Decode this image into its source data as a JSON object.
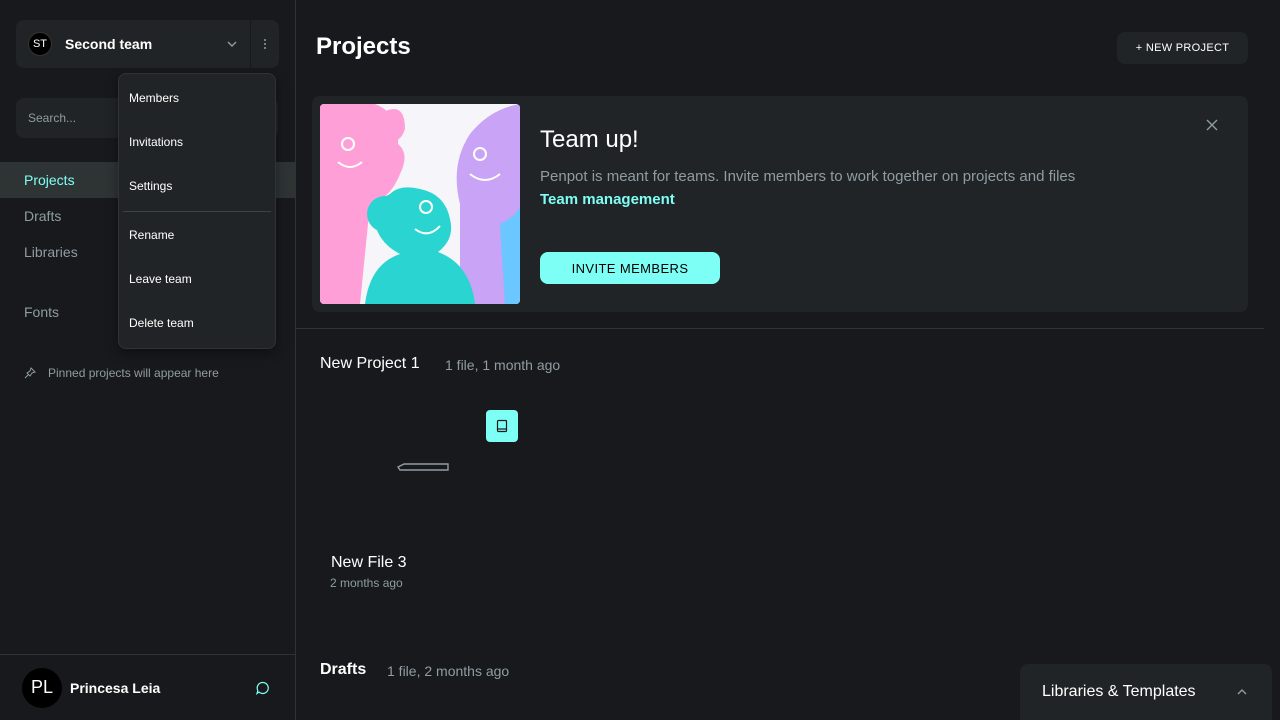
{
  "sidebar": {
    "team": {
      "initials": "ST",
      "name": "Second team"
    },
    "search_placeholder": "Search...",
    "nav": [
      {
        "label": "Projects",
        "active": true
      },
      {
        "label": "Drafts",
        "active": false
      },
      {
        "label": "Libraries",
        "active": false
      },
      {
        "label": "Fonts",
        "active": false
      }
    ],
    "pinned_note": "Pinned projects will appear here",
    "profile": {
      "initials": "PL",
      "name": "Princesa Leia"
    }
  },
  "team_menu": {
    "items": [
      "Members",
      "Invitations",
      "Settings",
      "Rename",
      "Leave team",
      "Delete team"
    ]
  },
  "main": {
    "title": "Projects",
    "new_project_label": "+ NEW PROJECT",
    "banner": {
      "heading": "Team up!",
      "text": "Penpot is meant for teams. Invite members to work together on projects and files",
      "link": "Team management",
      "invite_label": "INVITE MEMBERS"
    },
    "project": {
      "name": "New Project 1",
      "meta": "1 file, 1 month ago",
      "file": {
        "name": "New File 3",
        "date": "2 months ago"
      }
    },
    "drafts": {
      "title": "Drafts",
      "meta": "1 file, 2 months ago"
    },
    "libraries_panel": {
      "title": "Libraries & Templates"
    }
  },
  "colors": {
    "accent": "#7efff5",
    "background": "#18191c",
    "surface": "#212426",
    "text_muted": "#8f9da3"
  },
  "icons": [
    "chevron-down-icon",
    "menu-dots-icon",
    "pin-icon",
    "chat-icon",
    "close-icon",
    "library-icon",
    "chevron-up-icon"
  ]
}
